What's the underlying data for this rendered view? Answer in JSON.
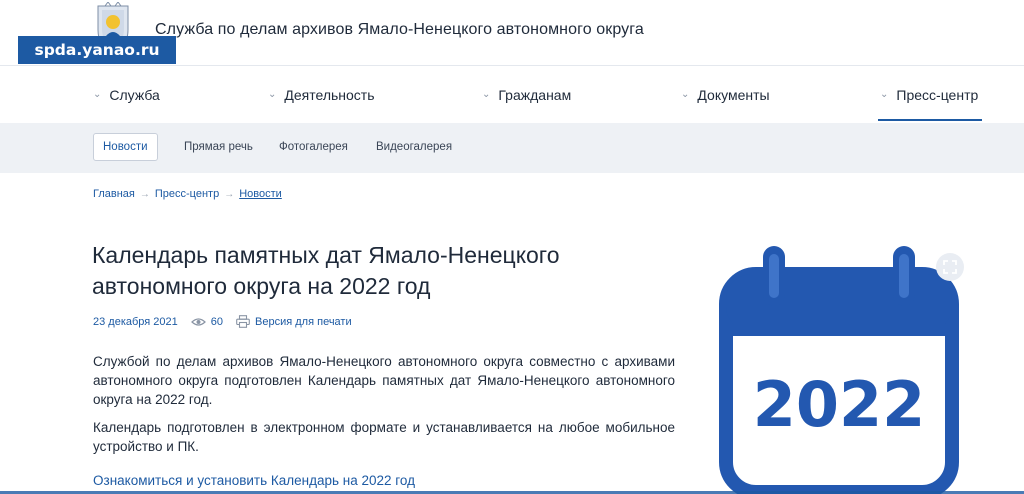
{
  "header": {
    "site_title": "Служба по делам архивов Ямало-Ненецкого автономного округа",
    "domain_badge": "spda.yanao.ru",
    "emblem_icon": "coat-of-arms-icon"
  },
  "main_nav": {
    "items": [
      {
        "label": "Служба"
      },
      {
        "label": "Деятельность"
      },
      {
        "label": "Гражданам"
      },
      {
        "label": "Документы"
      },
      {
        "label": "Пресс-центр",
        "active": true
      }
    ]
  },
  "sub_nav": {
    "items": [
      {
        "label": "Новости",
        "active": true
      },
      {
        "label": "Прямая речь"
      },
      {
        "label": "Фотогалерея"
      },
      {
        "label": "Видеогалерея"
      }
    ]
  },
  "breadcrumb": {
    "items": [
      "Главная",
      "Пресс-центр",
      "Новости"
    ]
  },
  "article": {
    "title": "Календарь памятных дат Ямало-Ненецкого автономного округа на 2022 год",
    "date": "23 декабря 2021",
    "views": "60",
    "print_label": "Версия для печати",
    "paragraphs": [
      "Службой по делам архивов Ямало-Ненецкого автономного округа совместно с архивами автономного округа подготовлен Календарь памятных дат Ямало-Ненецкого автономного округа на 2022 год.",
      "Календарь подготовлен в электронном формате и устанавливается на любое мобильное устройство и ПК."
    ],
    "link_text": "Ознакомиться и установить Календарь на 2022 год"
  },
  "image": {
    "calendar_year": "2022",
    "accent_color": "#2358b0"
  },
  "colors": {
    "brand": "#1d5aa3",
    "subnav_bg": "#eef1f5"
  }
}
